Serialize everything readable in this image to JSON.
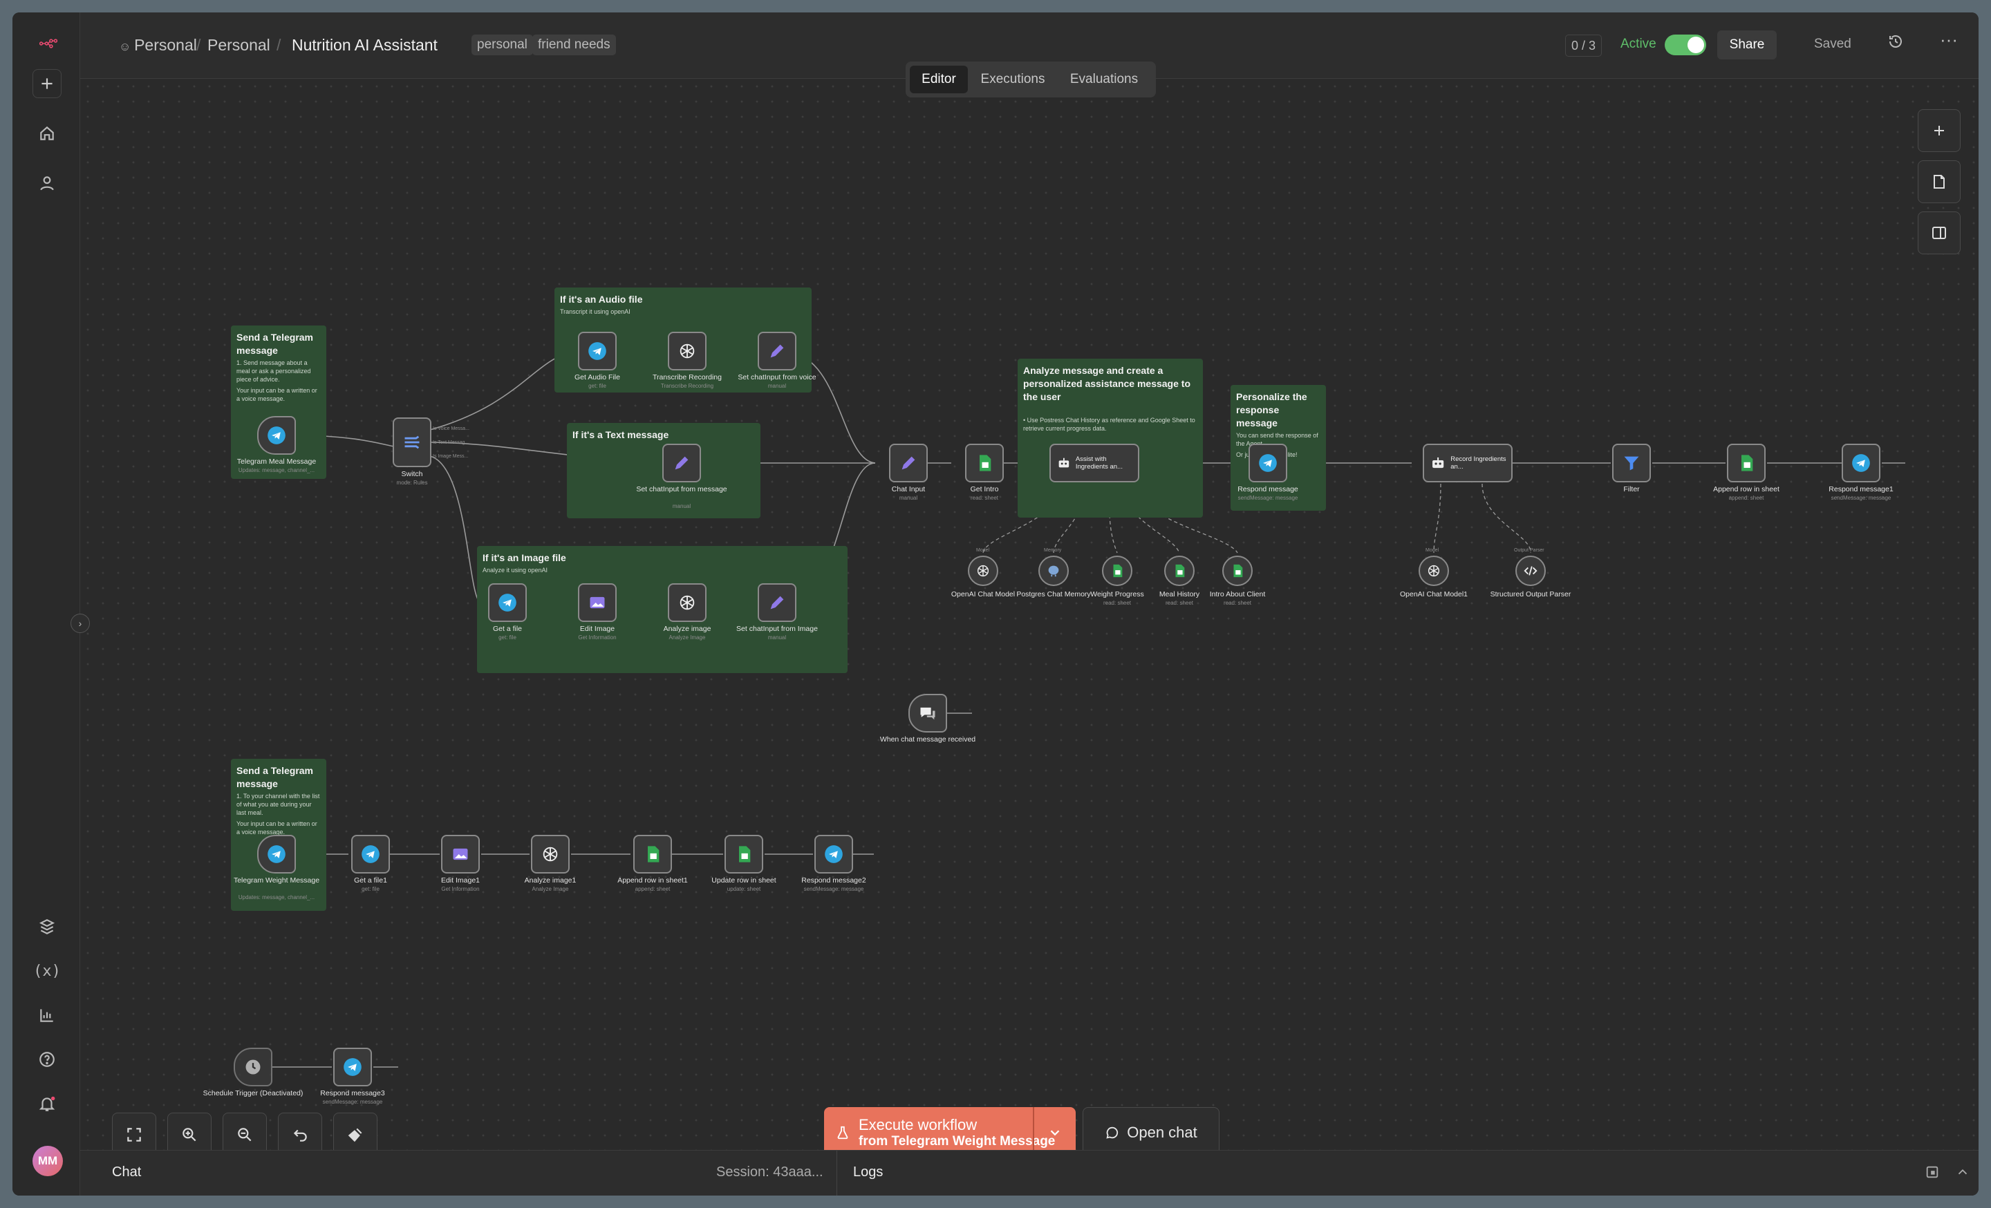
{
  "breadcrumb": {
    "owner": "Personal",
    "project": "Personal",
    "workflow": "Nutrition AI Assistant"
  },
  "tags": [
    "personal",
    "friend needs"
  ],
  "header": {
    "counter": "0 / 3",
    "active_label": "Active",
    "share": "Share",
    "saved": "Saved"
  },
  "tabs": [
    "Editor",
    "Executions",
    "Evaluations"
  ],
  "user": {
    "initials": "MM"
  },
  "stickies": {
    "send1": {
      "title": "Send a Telegram message",
      "body": [
        "1. Send message about a meal or ask a personalized piece of advice.",
        "Your input can be a written or a voice message."
      ]
    },
    "audio": {
      "title": "If it's an Audio file",
      "body": [
        "Transcript it using openAI"
      ]
    },
    "text": {
      "title": "If it's a Text message",
      "body": []
    },
    "image": {
      "title": "If it's an Image file",
      "body": [
        "Analyze it using openAI"
      ]
    },
    "analyze": {
      "title": "Analyze message and create a personalized assistance message to the user",
      "body": [
        "• Use Postress Chat History as reference and Google Sheet to retrieve current progress data."
      ]
    },
    "personalize": {
      "title": "Personalize the response message",
      "body": [
        "You can send the response of the Agent",
        "Or just be more polite!"
      ]
    },
    "send2": {
      "title": "Send a Telegram message",
      "body": [
        "1. To your channel with the list of what you ate during your last meal.",
        "Your input can be a written or a voice message."
      ]
    }
  },
  "nodes": {
    "tg_meal": {
      "label": "Telegram Meal Message",
      "sub": "Updates: message, channel_..."
    },
    "switch": {
      "label": "Switch",
      "sub": "mode: Rules"
    },
    "get_audio": {
      "label": "Get Audio File",
      "sub": "get: file"
    },
    "transcribe": {
      "label": "Transcribe Recording",
      "sub": "Transcribe Recording"
    },
    "set_voice": {
      "label": "Set chatInput from voice",
      "sub": "manual"
    },
    "set_msg": {
      "label": "Set chatInput from message",
      "sub": "manual"
    },
    "get_file": {
      "label": "Get a file",
      "sub": "get: file"
    },
    "edit_image": {
      "label": "Edit Image",
      "sub": "Get Information"
    },
    "analyze_image": {
      "label": "Analyze image",
      "sub": "Analyze Image"
    },
    "set_image": {
      "label": "Set chatInput from Image",
      "sub": "manual"
    },
    "chat_input": {
      "label": "Chat Input",
      "sub": "manual"
    },
    "get_intro": {
      "label": "Get Intro",
      "sub": "read: sheet"
    },
    "assist": {
      "label": "Assist with Ingredients an...",
      "sub": ""
    },
    "respond": {
      "label": "Respond message",
      "sub": "sendMessage: message"
    },
    "record": {
      "label": "Record Ingredients an...",
      "sub": ""
    },
    "filter": {
      "label": "Filter",
      "sub": ""
    },
    "append_row": {
      "label": "Append row in sheet",
      "sub": "append: sheet"
    },
    "respond1": {
      "label": "Respond message1",
      "sub": "sendMessage: message"
    },
    "openai_model": {
      "label": "OpenAI Chat Model",
      "sub": ""
    },
    "postgres": {
      "label": "Postgres Chat Memory",
      "sub": ""
    },
    "weight": {
      "label": "Weight Progress",
      "sub": "read: sheet"
    },
    "meal_history": {
      "label": "Meal History",
      "sub": "read: sheet"
    },
    "intro_client": {
      "label": "Intro About Client",
      "sub": "read: sheet"
    },
    "openai_model1": {
      "label": "OpenAI Chat Model1",
      "sub": ""
    },
    "parser": {
      "label": "Structured Output Parser",
      "sub": ""
    },
    "chat_trigger": {
      "label": "When chat message received",
      "sub": ""
    },
    "tg_weight": {
      "label": "Telegram Weight Message",
      "sub": "Updates: message, channel_..."
    },
    "get_file1": {
      "label": "Get a file1",
      "sub": "get: file"
    },
    "edit_image1": {
      "label": "Edit Image1",
      "sub": "Get Information"
    },
    "analyze_image1": {
      "label": "Analyze image1",
      "sub": "Analyze Image"
    },
    "append_row1": {
      "label": "Append row in sheet1",
      "sub": "append: sheet"
    },
    "update_row": {
      "label": "Update row in sheet",
      "sub": "update: sheet"
    },
    "respond2": {
      "label": "Respond message2",
      "sub": "sendMessage: message"
    },
    "schedule": {
      "label": "Schedule Trigger (Deactivated)",
      "sub": ""
    },
    "respond3": {
      "label": "Respond message3",
      "sub": "sendMessage: message"
    }
  },
  "wire_labels": {
    "switch_out1": "Is Voice Messa...",
    "switch_out2": "Is Text Messag...",
    "switch_out3": "Is Image Mess...",
    "model": "Model",
    "memory": "Memory",
    "tool": "Tool",
    "chat_model": "Chat Model",
    "output_parser": "Output Parser"
  },
  "execute": {
    "title": "Execute workflow",
    "subtitle": "from Telegram Weight Message"
  },
  "open_chat": "Open chat",
  "bottom": {
    "chat": "Chat",
    "session": "Session: 43aaa...",
    "logs": "Logs"
  },
  "colors": {
    "accent": "#ea6b51",
    "active": "#5fbf6a",
    "sticky": "#2e4e33",
    "telegram": "#2ea5e0",
    "sheets": "#34a853",
    "edit": "#8f79e8"
  }
}
